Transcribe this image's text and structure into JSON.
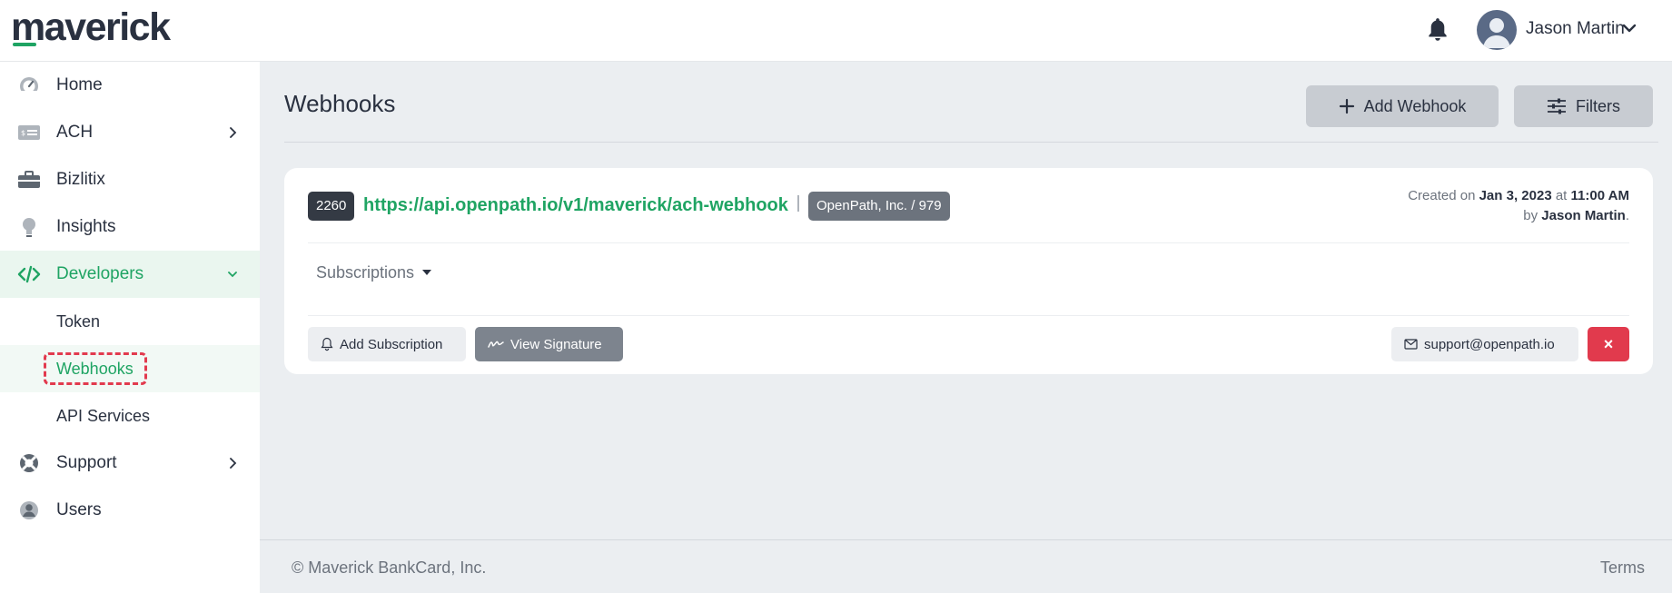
{
  "brand": {
    "name": "maverick",
    "accent": "#1fa463"
  },
  "header": {
    "user_name": "Jason Martin"
  },
  "sidebar": {
    "items": [
      {
        "label": "Home",
        "icon": "speedometer-icon"
      },
      {
        "label": "ACH",
        "icon": "check-card-icon",
        "expandable": true
      },
      {
        "label": "Bizlitix",
        "icon": "briefcase-icon"
      },
      {
        "label": "Insights",
        "icon": "lightbulb-icon"
      },
      {
        "label": "Developers",
        "icon": "code-icon",
        "expanded": true,
        "active": true
      },
      {
        "label": "Support",
        "icon": "lifebuoy-icon",
        "expandable": true
      },
      {
        "label": "Users",
        "icon": "user-circle-icon"
      }
    ],
    "developer_children": [
      {
        "label": "Token"
      },
      {
        "label": "Webhooks",
        "active": true
      },
      {
        "label": "API Services"
      }
    ]
  },
  "main": {
    "title": "Webhooks",
    "add_webhook_label": "Add Webhook",
    "filters_label": "Filters"
  },
  "webhook": {
    "id": "2260",
    "url": "https://api.openpath.io/v1/maverick/ach-webhook",
    "organization": "OpenPath, Inc. / 979",
    "created_prefix": "Created on",
    "created_date": "Jan 3, 2023",
    "created_at_word": "at",
    "created_time": "11:00 AM",
    "created_by_prefix": "by",
    "created_by": "Jason Martin",
    "subscriptions_label": "Subscriptions",
    "add_subscription_label": "Add Subscription",
    "view_signature_label": "View Signature",
    "contact_email": "support@openpath.io",
    "delete_symbol": "×"
  },
  "footer": {
    "copyright": "© Maverick BankCard, Inc.",
    "terms": "Terms"
  }
}
